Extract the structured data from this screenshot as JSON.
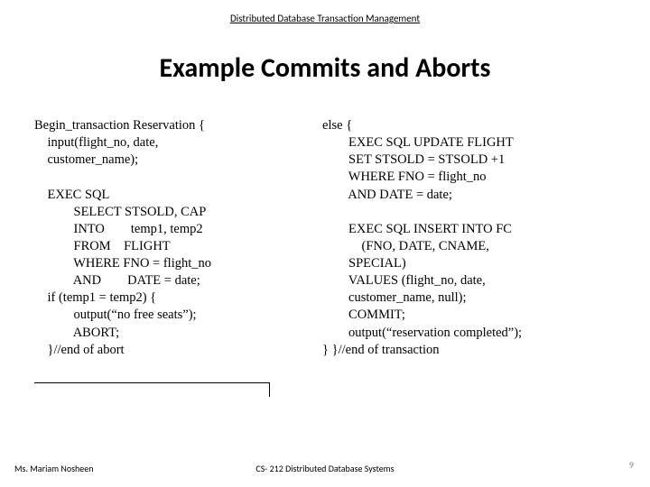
{
  "header": "Distributed Database Transaction Management",
  "title": "Example Commits and Aborts",
  "left_code": "Begin_transaction Reservation {\n    input(flight_no, date,\n    customer_name);\n\n    EXEC SQL\n            SELECT STSOLD, CAP\n            INTO        temp1, temp2\n            FROM    FLIGHT\n            WHERE FNO = flight_no\n            AND        DATE = date;\n    if (temp1 = temp2) {\n            output(“no free seats”);\n            ABORT;\n    }//end of abort",
  "right_code": "else {\n        EXEC SQL UPDATE FLIGHT\n        SET STSOLD = STSOLD +1\n        WHERE FNO = flight_no\n        AND DATE = date;\n\n        EXEC SQL INSERT INTO FC\n            (FNO, DATE, CNAME,\n        SPECIAL)\n        VALUES (flight_no, date,\n        customer_name, null);\n        COMMIT;\n        output(“reservation completed”);\n} }//end of transaction",
  "footer_left": "Ms. Mariam Nosheen",
  "footer_center": "CS- 212 Distributed Database Systems",
  "page_number": "9"
}
